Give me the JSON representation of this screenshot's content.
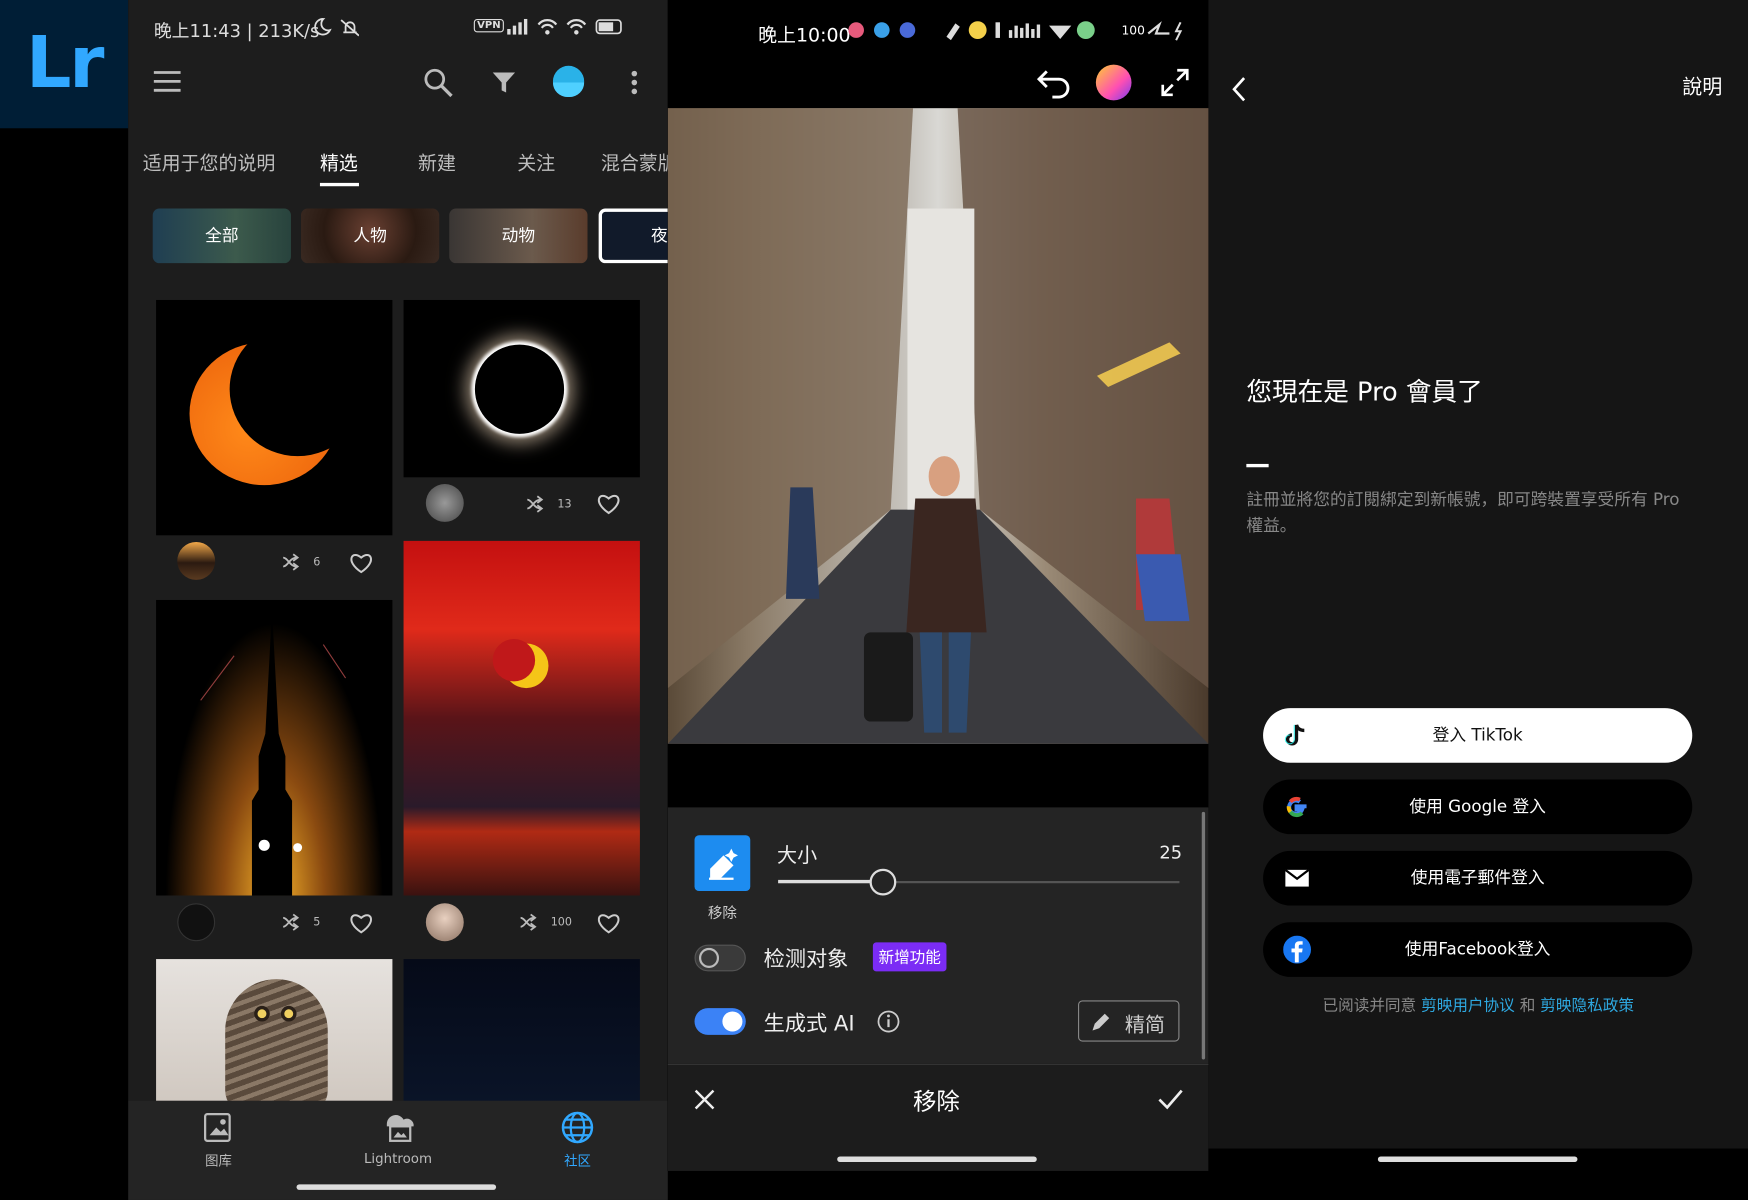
{
  "logo": {
    "text": "Lr"
  },
  "panel_community": {
    "status_bar": {
      "text": "晚上11:43 | 213K/s",
      "icons": [
        "moon-icon",
        "bell-off-icon",
        "vpn-icon",
        "hd-signal-icon",
        "wifi-icon",
        "wifi-icon",
        "battery-icon"
      ],
      "vpn_label": "VPN",
      "battery": "61"
    },
    "tabs": [
      {
        "label": "适用于您的说明"
      },
      {
        "label": "精选",
        "active": true
      },
      {
        "label": "新建"
      },
      {
        "label": "关注"
      },
      {
        "label": "混合蒙版"
      }
    ],
    "chips": [
      {
        "label": "全部"
      },
      {
        "label": "人物"
      },
      {
        "label": "动物"
      },
      {
        "label": "夜"
      }
    ],
    "cards": [
      {
        "remix_count": "6"
      },
      {
        "remix_count": "13"
      },
      {
        "remix_count": "5"
      },
      {
        "remix_count": "100"
      }
    ],
    "bottom_nav": [
      {
        "label": "图库"
      },
      {
        "label": "Lightroom"
      },
      {
        "label": "社区",
        "active": true
      }
    ],
    "colors": {
      "accent": "#31a8ff",
      "background": "#1d1d1d"
    }
  },
  "panel_remove": {
    "status_bar": {
      "text": "晚上10:00",
      "battery": "100"
    },
    "tool": {
      "label": "移除",
      "size_label": "大小",
      "size_value": "25",
      "size_fraction": 0.25
    },
    "detect_objects": {
      "label": "检测对象",
      "badge": "新增功能",
      "enabled": false
    },
    "generative_ai": {
      "label": "生成式 AI",
      "enabled": true,
      "refine_label": "精简"
    },
    "footer": {
      "title": "移除"
    },
    "colors": {
      "toggle_on": "#3b82f6",
      "badge": "#7b2cf5"
    }
  },
  "panel_login": {
    "header": {
      "help": "說明"
    },
    "title": "您現在是 Pro 會員了",
    "description": "註冊並將您的訂閱綁定到新帳號，即可跨裝置享受所有 Pro 權益。",
    "buttons": [
      {
        "label": "登入 TikTok",
        "icon": "tiktok-icon"
      },
      {
        "label": "使用 Google 登入",
        "icon": "google-icon"
      },
      {
        "label": "使用電子郵件登入",
        "icon": "mail-icon"
      },
      {
        "label": "使用Facebook登入",
        "icon": "facebook-icon"
      }
    ],
    "agreement": {
      "prefix": "已阅读并同意",
      "link1": "剪映用户协议",
      "joiner": "和",
      "link2": "剪映隐私政策"
    },
    "colors": {
      "link": "#2ea8e0"
    }
  }
}
